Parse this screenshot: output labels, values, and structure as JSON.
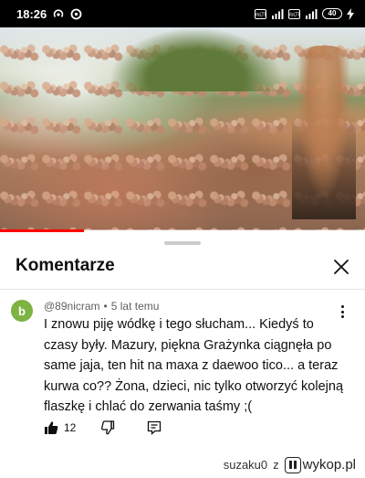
{
  "status_bar": {
    "time": "18:26",
    "battery": "40",
    "icons": [
      "hotspot-icon",
      "sync-icon",
      "volte-icon",
      "signal-icon",
      "battery-icon",
      "charging-icon"
    ]
  },
  "video": {
    "progress_fraction": 0.23
  },
  "comments_sheet": {
    "title": "Komentarze",
    "comment": {
      "avatar_letter": "b",
      "avatar_color": "#7cb342",
      "author": "@89nicram",
      "separator": "•",
      "time_ago": "5 lat temu",
      "text": "I znowu piję wódkę i tego słucham... Kiedyś to czasy były. Mazury, piękna Grażynka ciągnęła po same jaja, ten hit na maxa z daewoo tico... a teraz kurwa co?? Żona, dzieci, nic tylko otworzyć kolejną flaszkę i chlać do zerwania taśmy ;(",
      "likes": "12"
    }
  },
  "watermark": {
    "user": "suzaku0",
    "word": "z",
    "site": "wykop.pl"
  },
  "colors": {
    "accent_red": "#ff0000",
    "text_primary": "#0f0f0f",
    "text_secondary": "#606060"
  }
}
